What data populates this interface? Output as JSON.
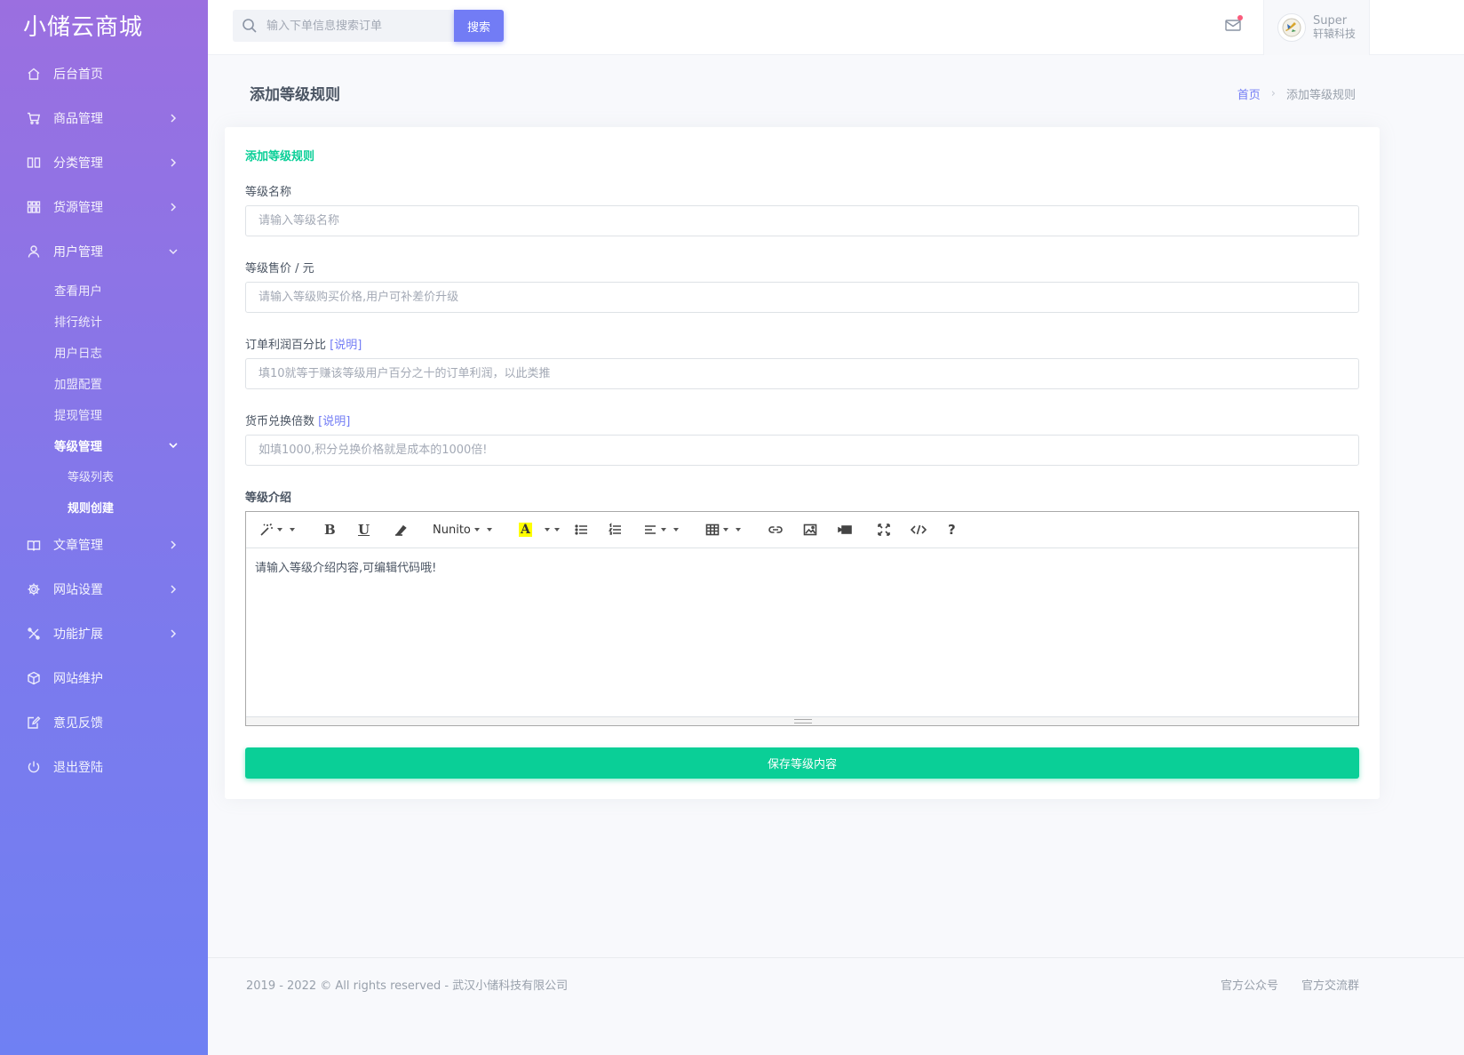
{
  "app": {
    "logo": "小储云商城"
  },
  "sidebar": {
    "items": [
      {
        "label": "后台首页",
        "icon": "home-icon"
      },
      {
        "label": "商品管理",
        "icon": "cart-icon"
      },
      {
        "label": "分类管理",
        "icon": "columns-icon"
      },
      {
        "label": "货源管理",
        "icon": "grid-icon"
      },
      {
        "label": "用户管理",
        "icon": "user-icon"
      },
      {
        "label": "文章管理",
        "icon": "book-icon"
      },
      {
        "label": "网站设置",
        "icon": "gear-icon"
      },
      {
        "label": "功能扩展",
        "icon": "tools-icon"
      },
      {
        "label": "网站维护",
        "icon": "box-icon"
      },
      {
        "label": "意见反馈",
        "icon": "edit-icon"
      },
      {
        "label": "退出登陆",
        "icon": "power-icon"
      }
    ],
    "user_sub": [
      "查看用户",
      "排行统计",
      "用户日志",
      "加盟配置",
      "提现管理",
      "等级管理"
    ],
    "level_sub": [
      "等级列表",
      "规则创建"
    ]
  },
  "topbar": {
    "search_placeholder": "输入下单信息搜索订单",
    "search_button": "搜索",
    "user_name": "Super",
    "user_company": "轩辕科技"
  },
  "page": {
    "title": "添加等级规则",
    "breadcrumb_home": "首页",
    "breadcrumb_separator": "›",
    "breadcrumb_current": "添加等级规则"
  },
  "form": {
    "card_title": "添加等级规则",
    "name_label": "等级名称",
    "name_placeholder": "请输入等级名称",
    "price_label": "等级售价 / 元",
    "price_placeholder": "请输入等级购买价格,用户可补差价升级",
    "profit_label": "订单利润百分比",
    "profit_link": "[说明]",
    "profit_placeholder": "填10就等于赚该等级用户百分之十的订单利润，以此类推",
    "currency_label": "货币兑换倍数",
    "currency_link": "[说明]",
    "currency_placeholder": "如填1000,积分兑换价格就是成本的1000倍!",
    "intro_label": "等级介绍",
    "editor_font": "Nunito",
    "editor_bold": "B",
    "editor_underline": "U",
    "editor_highlight": "A",
    "editor_help": "?",
    "editor_content": "请输入等级介绍内容,可编辑代码哦!",
    "save_button": "保存等级内容"
  },
  "footer": {
    "copyright": "2019 - 2022 © All rights reserved - 武汉小储科技有限公司",
    "link1": "官方公众号",
    "link2": "官方交流群"
  },
  "colors": {
    "primary": "#727cf5",
    "success": "#0acf97",
    "sidebar_top": "#9b6fe0",
    "sidebar_bottom": "#6f80f3"
  }
}
